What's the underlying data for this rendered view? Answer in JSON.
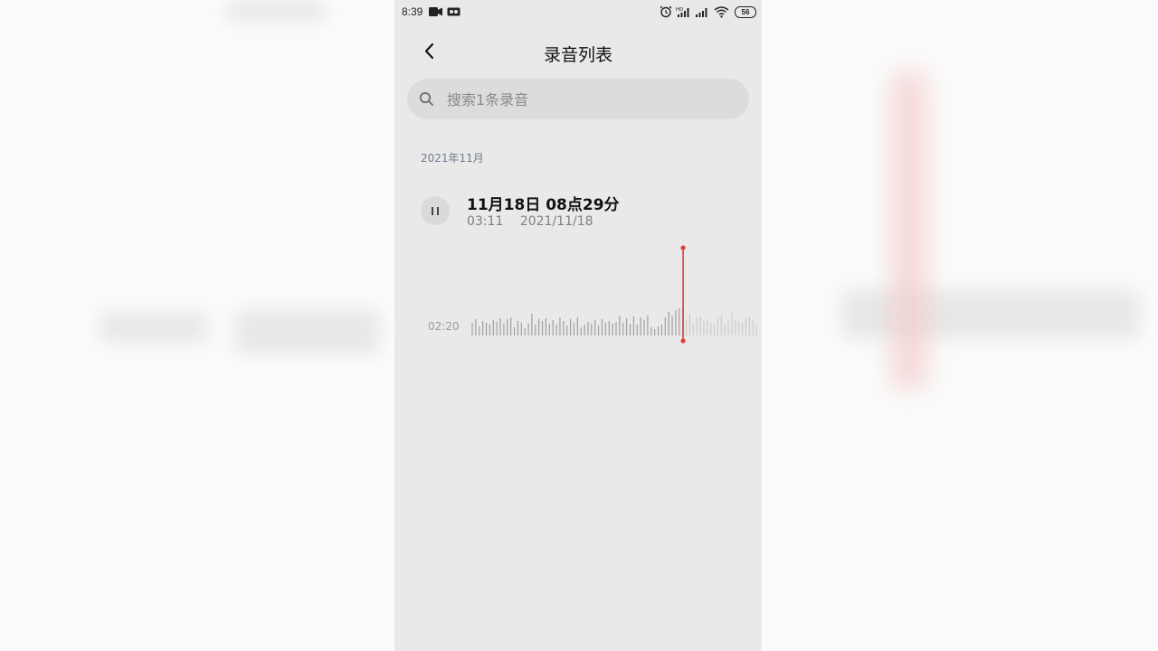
{
  "status_bar": {
    "time": "8:39",
    "battery": "56",
    "icons": [
      "video-record-icon",
      "screen-record-icon",
      "alarm-icon",
      "hd-signal-icon",
      "signal-icon",
      "wifi-icon",
      "battery-icon"
    ]
  },
  "header": {
    "back_icon": "chevron-left-icon",
    "title": "录音列表"
  },
  "search": {
    "icon": "search-icon",
    "placeholder": "搜索1条录音",
    "value": ""
  },
  "list": {
    "group_label": "2021年11月",
    "items": [
      {
        "title": "11月18日 08点29分",
        "duration": "03:11",
        "date": "2021/11/18",
        "state": "playing",
        "control_icon": "pause-icon"
      }
    ]
  },
  "player": {
    "current_time": "02:20",
    "progress": 0.733,
    "playhead_color": "#e0403f"
  },
  "colors": {
    "background": "#e9e9e9",
    "search_bg": "#dcdcdc",
    "accent": "#e0403f"
  }
}
